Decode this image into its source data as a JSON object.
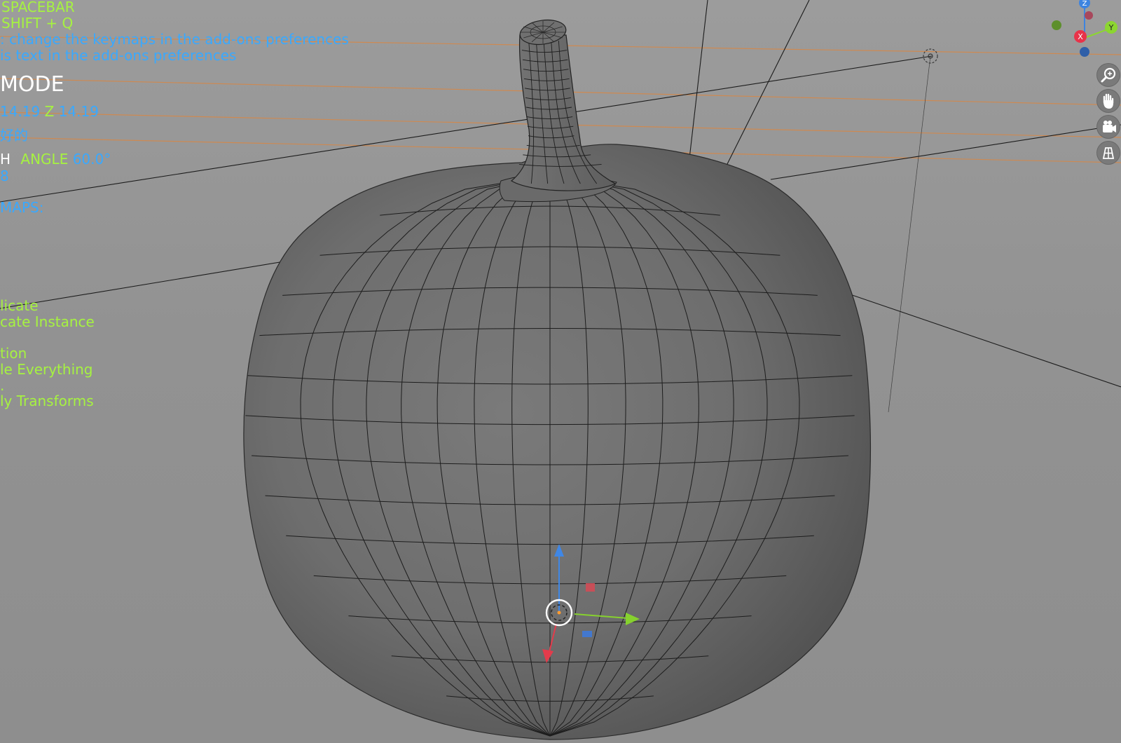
{
  "viewport": {
    "background": "#969696",
    "wire_color": "#1a1a1a",
    "mesh_fill": "#6c6c6c"
  },
  "overlay": {
    "shortcut_spacebar": "SPACEBAR",
    "shortcut_shift_q": "SHIFT + Q",
    "hint_keymaps": ": change the keymaps in the add-ons preferences",
    "hint_text": "is text in the add-ons preferences",
    "mode_label": "MODE",
    "coord_value_1": "14.19",
    "coord_axis_z": "Z",
    "coord_value_2": "14.19",
    "blue_token_1": "好的",
    "snap_prefix": "H",
    "angle_label": "ANGLE",
    "angle_value": "60.0°",
    "blue_token_2": "8",
    "keymaps_label": "MAPS:",
    "menu_items": [
      "licate",
      "cate Instance",
      "tion",
      "le Everything",
      "ly Transforms"
    ]
  },
  "gizmo": {
    "axis_x_label": "X",
    "axis_y_label": "Y",
    "axis_z_label": "Z",
    "x_color": "#e8334a",
    "y_color": "#8cd630",
    "z_color": "#3d84e0"
  },
  "nav_icons": [
    "zoom-icon",
    "pan-hand-icon",
    "camera-icon",
    "grid-view-icon"
  ]
}
